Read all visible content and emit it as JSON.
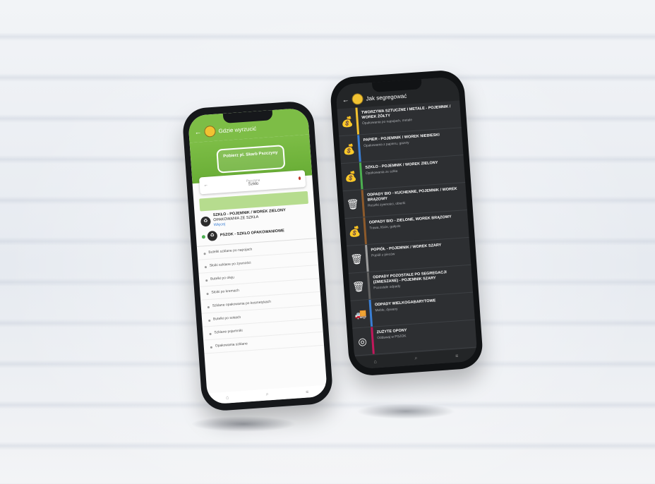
{
  "left_phone": {
    "title": "Gdzie wyrzucić",
    "hero_logo_text": "Pobierz pl. Skarb Pszczyny",
    "search_left": "Pszczyna",
    "search_value": "Szkło",
    "results": [
      {
        "title": "SZKŁO - POJEMNIK / WOREK ZIELONY",
        "sub": "OPAKOWANIA ZE SZKŁA",
        "link": "Więcej",
        "icon": "♻"
      },
      {
        "title": "PSZOK - SZKŁO OPAKOWANIOWE",
        "sub": "",
        "link": "",
        "icon": "♻"
      }
    ],
    "list": [
      "Butelki szklane po napojach",
      "Słoiki szklane po żywności",
      "Butelki po oleju",
      "Słoiki po kremach",
      "Szklane opakowania po kosmetykach",
      "Butelki po sokach",
      "Szklane pojemniki",
      "Opakowania szklane"
    ]
  },
  "right_phone": {
    "title": "Jak segregować",
    "rows": [
      {
        "title": "TWORZYWA SZTUCZNE I METALE - POJEMNIK / WOREK ŻÓŁTY",
        "sub": "Opakowania po napojach, metale",
        "stripe": "#f2c230",
        "icon": "💰"
      },
      {
        "title": "PAPIER - POJEMNIK / WOREK NIEBIESKI",
        "sub": "Opakowania z papieru, gazety",
        "stripe": "#3a7fd5",
        "icon": "💰"
      },
      {
        "title": "SZKŁO - POJEMNIK / WOREK ZIELONY",
        "sub": "Opakowania ze szkła",
        "stripe": "#4caf50",
        "icon": "💰"
      },
      {
        "title": "ODPADY BIO - KUCHENNE, POJEMNIK / WOREK BRĄZOWY",
        "sub": "Resztki żywności, obierki",
        "stripe": "#8d5a2b",
        "icon": "🗑"
      },
      {
        "title": "ODPADY BIO - ZIELONE, WOREK BRĄZOWY",
        "sub": "Trawa, liście, gałęzie",
        "stripe": "#8d5a2b",
        "icon": "💰"
      },
      {
        "title": "POPIÓŁ - POJEMNIK / WOREK SZARY",
        "sub": "Popiół z pieców",
        "stripe": "#9e9e9e",
        "icon": "🗑"
      },
      {
        "title": "ODPADY POZOSTAŁE PO SEGREGACJI (ZMIESZANE) - POJEMNIK SZARY",
        "sub": "Pozostałe odpady",
        "stripe": "#616161",
        "icon": "🗑"
      },
      {
        "title": "ODPADY WIELKOGABARYTOWE",
        "sub": "Meble, dywany",
        "stripe": "#3a7fd5",
        "icon": "🚚"
      },
      {
        "title": "ZUŻYTE OPONY",
        "sub": "Oddawaj w PSZOK",
        "stripe": "#c2185b",
        "icon": "◎"
      }
    ]
  }
}
